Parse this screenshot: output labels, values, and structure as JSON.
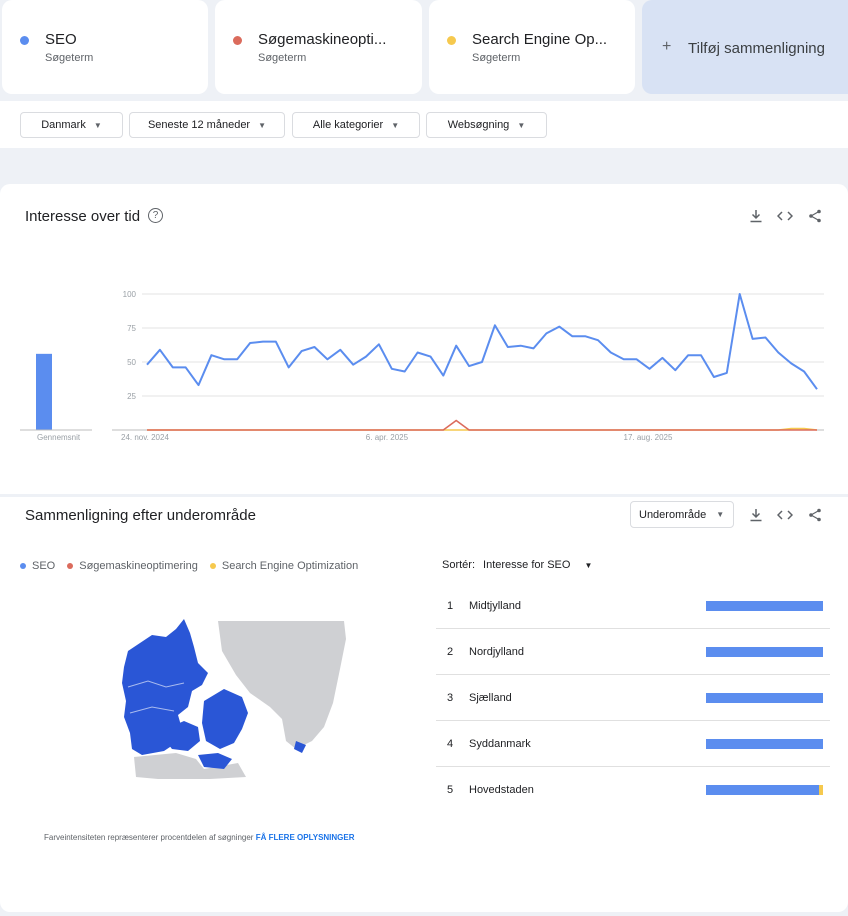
{
  "colors": {
    "seo": "#5b8def",
    "soge": "#db6b5c",
    "seo_en": "#f6c94e",
    "map_blue": "#2a56d6",
    "map_gray": "#cfd0d3"
  },
  "terms": [
    {
      "name": "SEO",
      "sub": "Søgeterm",
      "color": "#5b8def"
    },
    {
      "name": "Søgemaskineopti...",
      "sub": "Søgeterm",
      "color": "#db6b5c"
    },
    {
      "name": "Search Engine Op...",
      "sub": "Søgeterm",
      "color": "#f6c94e"
    }
  ],
  "add_compare": {
    "plus": "+",
    "label": "Tilføj sammenligning"
  },
  "filters": [
    {
      "label": "Danmark"
    },
    {
      "label": "Seneste 12 måneder"
    },
    {
      "label": "Alle kategorier"
    },
    {
      "label": "Websøgning"
    }
  ],
  "interest": {
    "title": "Interesse over tid",
    "help": "?",
    "average_label": "Gennemsnit"
  },
  "chart_data": {
    "type": "line",
    "title": "Interesse over tid",
    "ylim": [
      0,
      100
    ],
    "yticks": [
      25,
      50,
      75,
      100
    ],
    "x_tick_labels": [
      "24. nov. 2024",
      "6. apr. 2025",
      "17. aug. 2025"
    ],
    "x_tick_index": [
      0,
      19,
      39
    ],
    "series": [
      {
        "name": "SEO",
        "color": "#5b8def",
        "values": [
          48,
          59,
          46,
          46,
          33,
          55,
          52,
          52,
          64,
          65,
          65,
          46,
          58,
          61,
          52,
          59,
          48,
          54,
          63,
          45,
          43,
          57,
          54,
          40,
          62,
          47,
          50,
          77,
          61,
          62,
          60,
          71,
          76,
          69,
          69,
          66,
          57,
          52,
          52,
          45,
          53,
          44,
          55,
          55,
          39,
          42,
          100,
          67,
          68,
          57,
          49,
          43,
          30
        ]
      },
      {
        "name": "Søgemaskineoptimering",
        "color": "#db6b5c",
        "values": [
          0,
          0,
          0,
          0,
          0,
          0,
          0,
          0,
          0,
          0,
          0,
          0,
          0,
          0,
          0,
          0,
          0,
          0,
          0,
          0,
          0,
          0,
          0,
          0,
          7,
          0,
          0,
          0,
          0,
          0,
          0,
          0,
          0,
          0,
          0,
          0,
          0,
          0,
          0,
          0,
          0,
          0,
          0,
          0,
          0,
          0,
          0,
          0,
          0,
          0,
          0,
          0,
          0
        ]
      },
      {
        "name": "Search Engine Optimization",
        "color": "#f6c94e",
        "values": [
          0,
          0,
          0,
          0,
          0,
          0,
          0,
          0,
          0,
          0,
          0,
          0,
          0,
          0,
          0,
          0,
          0,
          0,
          0,
          0,
          0,
          0,
          0,
          0,
          0,
          0,
          0,
          0,
          0,
          0,
          0,
          0,
          0,
          0,
          0,
          0,
          0,
          0,
          0,
          0,
          0,
          0,
          0,
          0,
          0,
          0,
          0,
          0,
          0,
          0,
          1,
          1,
          0
        ]
      }
    ],
    "averages": [
      {
        "name": "SEO",
        "value": 56
      },
      {
        "name": "Søgemaskineoptimering",
        "value": 0
      },
      {
        "name": "Search Engine Optimization",
        "value": 0
      }
    ]
  },
  "region": {
    "title": "Sammenligning efter underområde",
    "select": "Underområde",
    "legend": [
      {
        "name": "SEO",
        "color": "#5b8def"
      },
      {
        "name": "Søgemaskineoptimering",
        "color": "#db6b5c"
      },
      {
        "name": "Search Engine Optimization",
        "color": "#f6c94e"
      }
    ],
    "sort_label": "Sortér:",
    "sort_value": "Interesse for SEO",
    "rows": [
      {
        "rank": "1",
        "name": "Midtjylland",
        "seo": 100,
        "soge": 0,
        "en": 0
      },
      {
        "rank": "2",
        "name": "Nordjylland",
        "seo": 100,
        "soge": 0,
        "en": 0
      },
      {
        "rank": "3",
        "name": "Sjælland",
        "seo": 100,
        "soge": 0,
        "en": 0
      },
      {
        "rank": "4",
        "name": "Syddanmark",
        "seo": 100,
        "soge": 0,
        "en": 0
      },
      {
        "rank": "5",
        "name": "Hovedstaden",
        "seo": 97,
        "soge": 0,
        "en": 3
      }
    ],
    "footnote": "Farveintensiteten repræsenterer procentdelen af søgninger",
    "footnote_link": "FÅ FLERE OPLYSNINGER"
  }
}
